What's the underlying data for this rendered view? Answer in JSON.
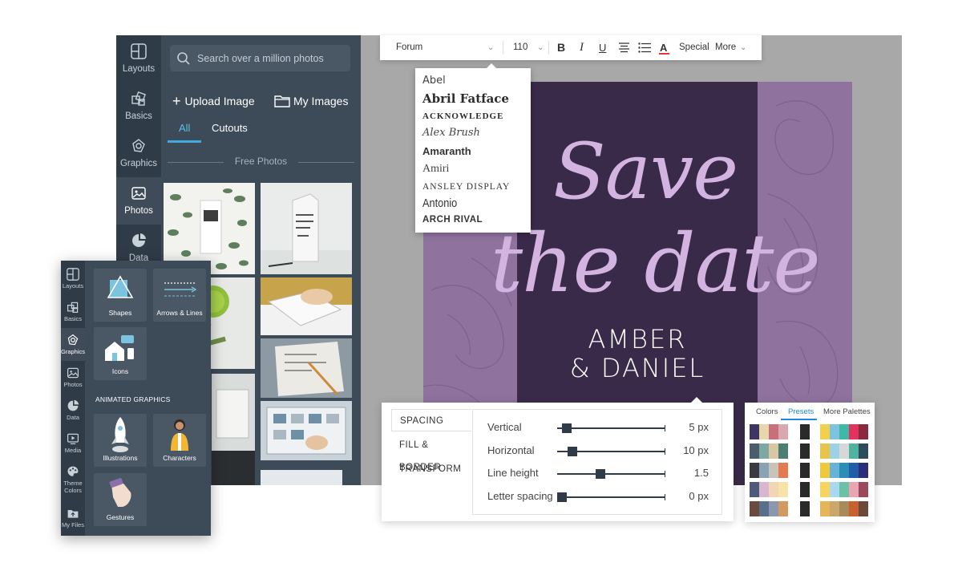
{
  "side_nav": {
    "items": [
      {
        "label": "Layouts",
        "icon": "layouts-icon"
      },
      {
        "label": "Basics",
        "icon": "basics-icon"
      },
      {
        "label": "Graphics",
        "icon": "graphics-icon"
      },
      {
        "label": "Photos",
        "icon": "photos-icon"
      },
      {
        "label": "Data",
        "icon": "data-icon"
      }
    ],
    "active": "Photos"
  },
  "photos_panel": {
    "search_placeholder": "Search over a million photos",
    "upload_label": "Upload Image",
    "my_images_label": "My Images",
    "tabs": [
      "All",
      "Cutouts"
    ],
    "active_tab": "All",
    "section_label": "Free Photos"
  },
  "toolbar": {
    "font": "Forum",
    "size": "110",
    "bold": "B",
    "italic": "I",
    "underline": "U",
    "text_color": "A",
    "special": "Special",
    "more": "More"
  },
  "font_dropdown": {
    "options": [
      "Abel",
      "Abril Fatface",
      "ACKNOWLEDGE",
      "Alex Brush",
      "Amaranth",
      "Amiri",
      "ANSLEY DISPLAY",
      "Antonio",
      "ARCH RIVAL"
    ]
  },
  "design": {
    "line1": "Save",
    "line2": "the date",
    "name1": "AMBER",
    "name2": "& DANIEL",
    "colors": {
      "outer": "#8f729e",
      "band": "#3a2a4a",
      "script": "#d3b4e0"
    }
  },
  "spacing_panel": {
    "tabs": [
      "SPACING",
      "FILL & BORDER",
      "TRANSFORM"
    ],
    "active_tab": "SPACING",
    "rows": [
      {
        "label": "Vertical",
        "value": "5 px",
        "level": 0.05
      },
      {
        "label": "Horizontal",
        "value": "10 px",
        "level": 0.1
      },
      {
        "label": "Line height",
        "value": "1.5",
        "level": 0.37
      },
      {
        "label": "Letter spacing",
        "value": "0 px",
        "level": 0.0
      }
    ]
  },
  "palette_panel": {
    "tabs": [
      "Colors",
      "Presets",
      "More Palettes"
    ],
    "active_tab": "Presets"
  },
  "graphics_window": {
    "nav": [
      {
        "label": "Layouts",
        "icon": "layouts-icon"
      },
      {
        "label": "Basics",
        "icon": "basics-icon"
      },
      {
        "label": "Graphics",
        "icon": "graphics-icon"
      },
      {
        "label": "Photos",
        "icon": "photos-icon"
      },
      {
        "label": "Data",
        "icon": "data-icon"
      },
      {
        "label": "Media",
        "icon": "media-icon"
      },
      {
        "label": "Theme Colors",
        "icon": "palette-icon"
      },
      {
        "label": "My Files",
        "icon": "files-icon"
      }
    ],
    "active": "Graphics",
    "tiles": [
      "Shapes",
      "Arrows & Lines",
      "Icons"
    ],
    "animated_heading": "ANIMATED GRAPHICS",
    "animated_tiles": [
      "Illustrations",
      "Characters",
      "Gestures"
    ]
  }
}
